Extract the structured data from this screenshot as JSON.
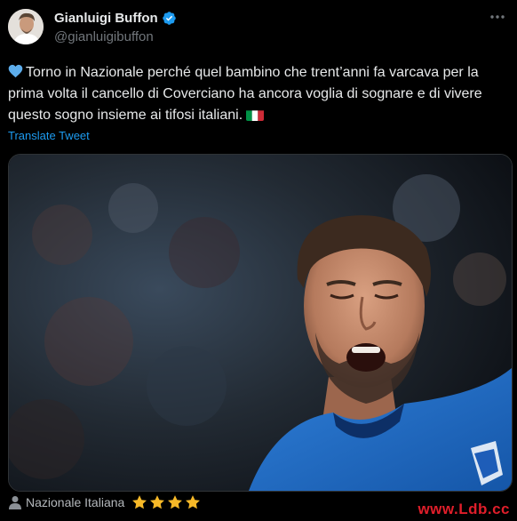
{
  "author": {
    "display_name": "Gianluigi Buffon",
    "handle": "@gianluigibuffon"
  },
  "icons": {
    "avatar": "profile-photo",
    "verified": "verified-badge-icon",
    "more": "more-options-icon",
    "heart": "blue-heart-emoji",
    "flag": "italy-flag-emoji",
    "person": "person-icon",
    "star": "star-emoji"
  },
  "tweet": {
    "text": "Torno in Nazionale perché quel bambino che trent’anni fa varcava per la prima volta il cancello di Coverciano ha ancora voglia di sognare e di vivere questo sogno insieme ai tifosi italiani.",
    "translate_label": "Translate Tweet"
  },
  "footer": {
    "label": "Nazionale Italiana",
    "stars": 4
  },
  "watermark": "www.Ldb.cc",
  "colors": {
    "background": "#000000",
    "text": "#e7e9ea",
    "muted": "#71767b",
    "link": "#1d9bf0",
    "star": "#f7b928",
    "heart": "#5dadec",
    "watermark": "#e01e2a"
  }
}
